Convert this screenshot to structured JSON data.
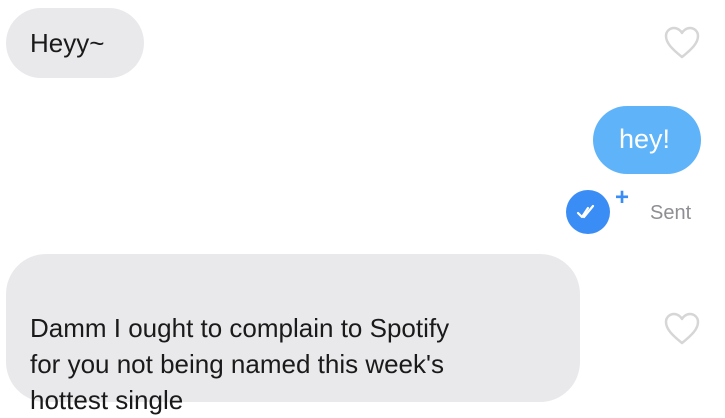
{
  "messages": {
    "incoming_1": {
      "text": "Heyy~"
    },
    "outgoing_1": {
      "text": "hey!",
      "status": "Sent",
      "status_plus": "+"
    },
    "incoming_2": {
      "text": "Damm I ought to complain to Spotify\nfor you not being named this week's\nhottest single"
    }
  },
  "icons": {
    "like": "heart-outline-icon",
    "read_receipt": "double-check-icon"
  },
  "colors": {
    "incoming_bubble": "#e9e9eb",
    "outgoing_bubble": "#5fb3f8",
    "accent": "#3a8df5",
    "status_text": "#8e8e93"
  }
}
